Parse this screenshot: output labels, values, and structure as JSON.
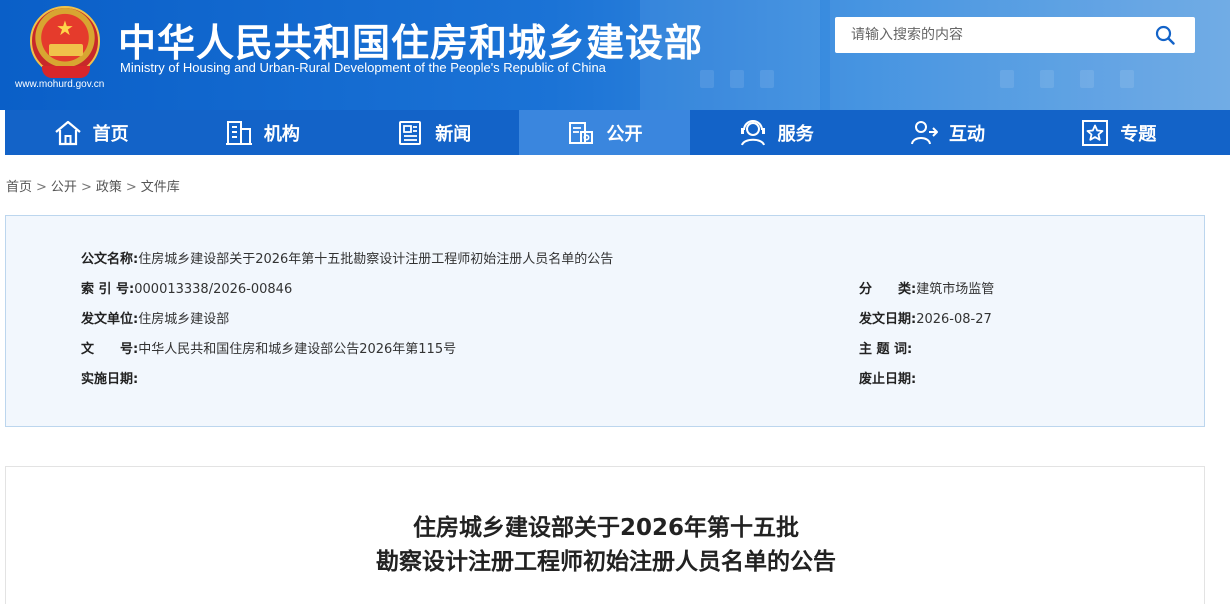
{
  "header": {
    "url": "www.mohurd.gov.cn",
    "title": "中华人民共和国住房和城乡建设部",
    "subtitle": "Ministry of Housing and Urban-Rural Development of the People's Republic of China",
    "search_placeholder": "请输入搜索的内容"
  },
  "nav": {
    "items": [
      {
        "label": "首页",
        "icon": "home-icon"
      },
      {
        "label": "机构",
        "icon": "building-icon"
      },
      {
        "label": "新闻",
        "icon": "news-icon"
      },
      {
        "label": "公开",
        "icon": "disclosure-icon",
        "active": true
      },
      {
        "label": "服务",
        "icon": "service-icon"
      },
      {
        "label": "互动",
        "icon": "interact-icon"
      },
      {
        "label": "专题",
        "icon": "star-icon"
      }
    ]
  },
  "breadcrumb": {
    "items": [
      "首页",
      "公开",
      "政策",
      "文件库"
    ],
    "separator": ">"
  },
  "info": {
    "doc_name_label": "公文名称:",
    "doc_name": "住房城乡建设部关于2026年第十五批勘察设计注册工程师初始注册人员名单的公告",
    "index_label": "索 引 号:",
    "index": "000013338/2026-00846",
    "category_label": "分　　类:",
    "category": "建筑市场监管",
    "issuer_label": "发文单位:",
    "issuer": "住房城乡建设部",
    "issue_date_label": "发文日期:",
    "issue_date": "2026-08-27",
    "doc_no_label": "文　　号:",
    "doc_no": "中华人民共和国住房和城乡建设部公告2026年第115号",
    "subject_label": "主 题 词:",
    "subject": "",
    "effective_label": "实施日期:",
    "effective": "",
    "expiry_label": "废止日期:",
    "expiry": ""
  },
  "article": {
    "title_line1": "住房城乡建设部关于2026年第十五批",
    "title_line2": "勘察设计注册工程师初始注册人员名单的公告"
  },
  "colors": {
    "nav_bg": "#1363c8",
    "nav_active": "#3a86de",
    "info_bg": "#f2f7fd",
    "info_border": "#bcd6ee"
  }
}
